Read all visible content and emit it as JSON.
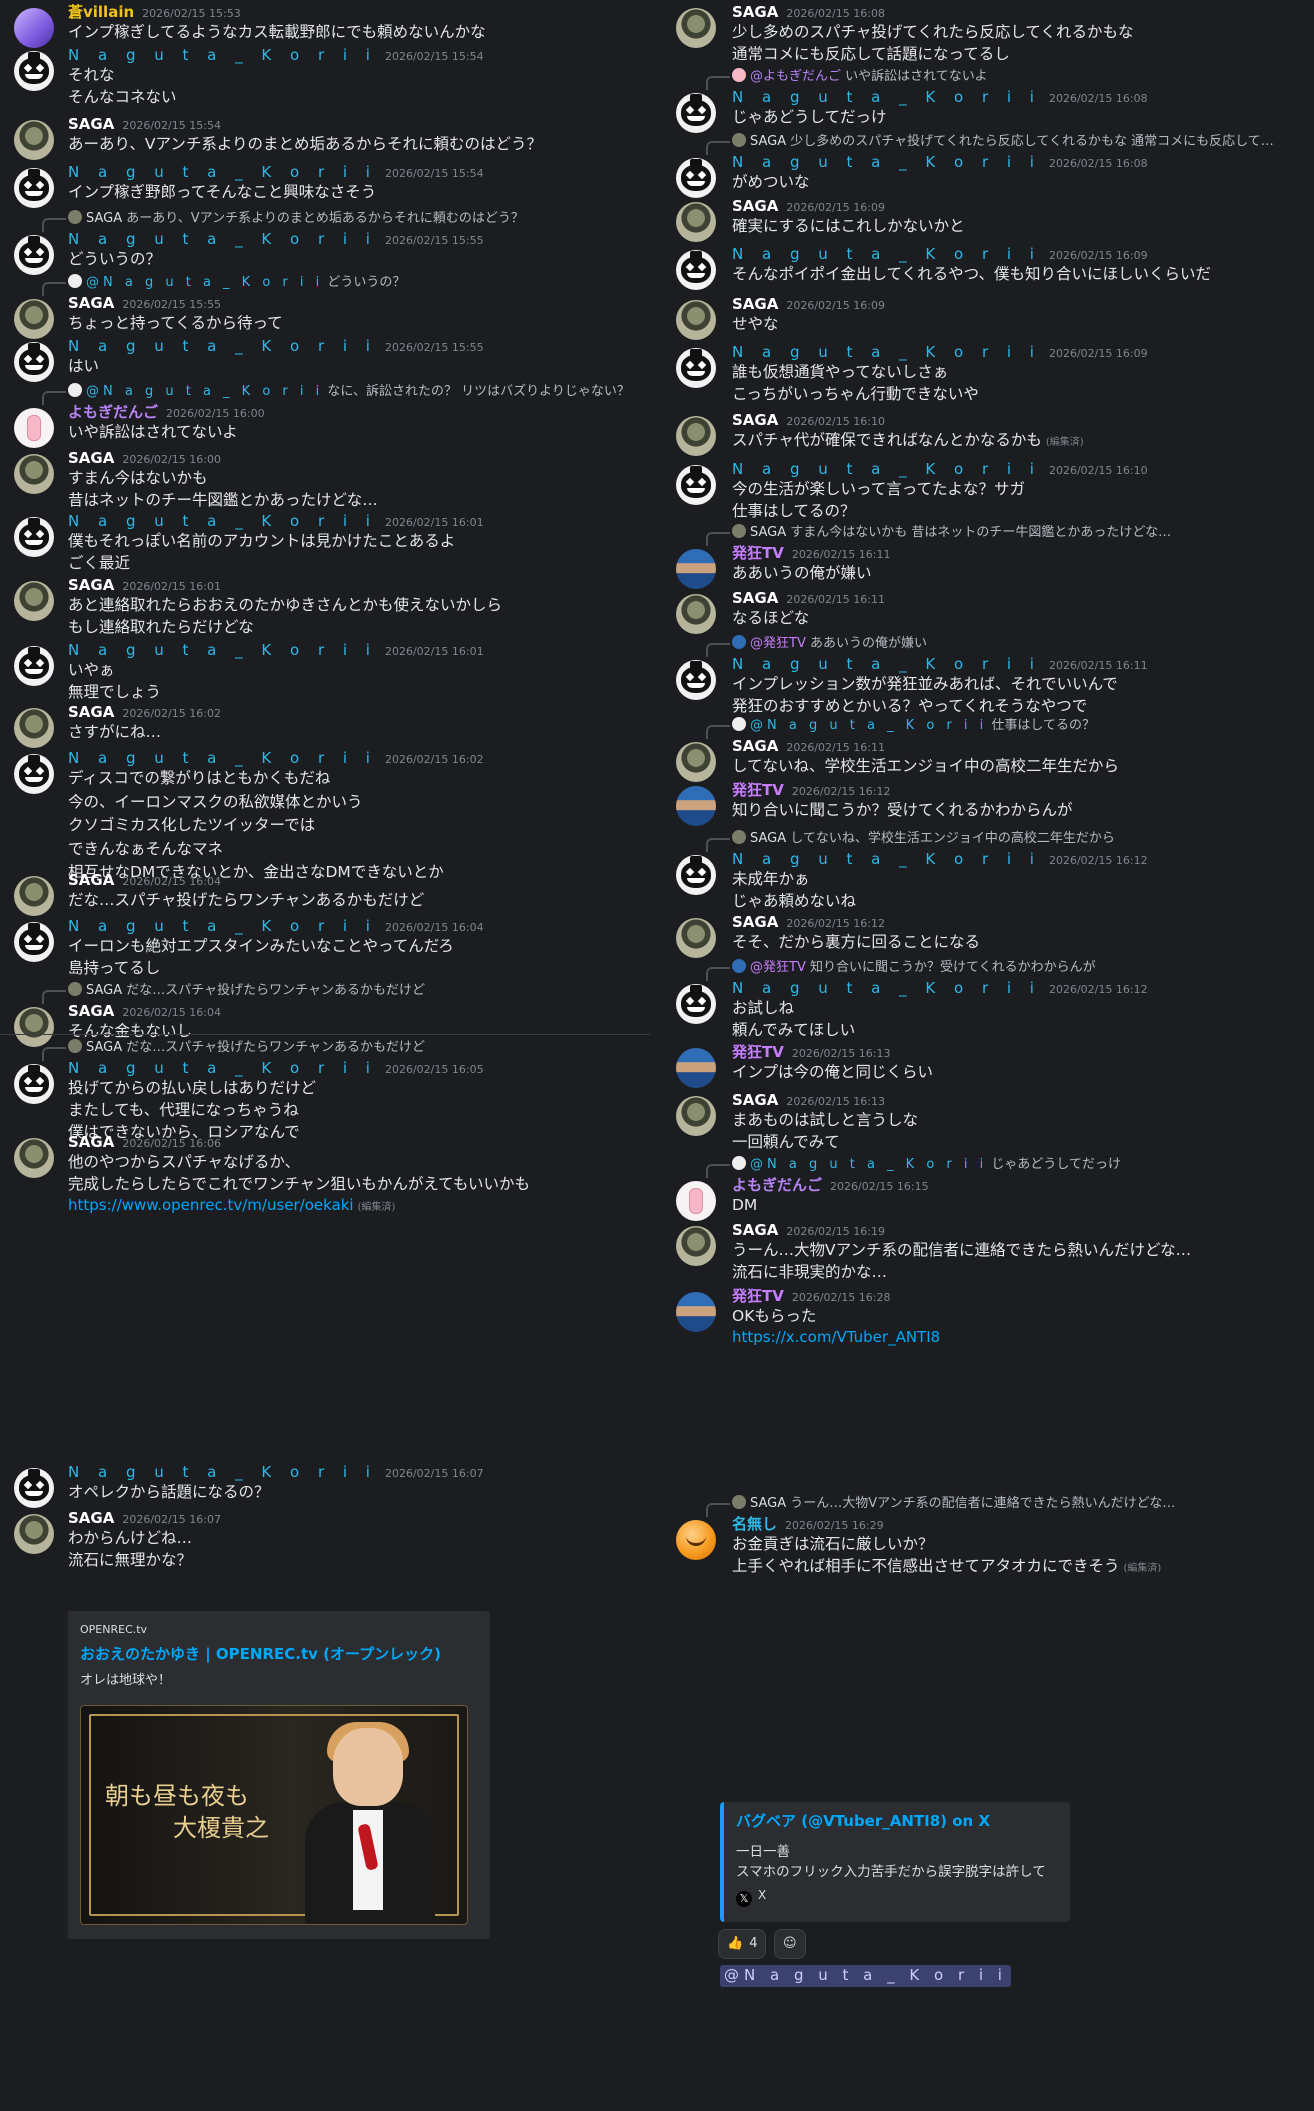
{
  "colors": {
    "background": "#1c1d21",
    "korii": "#2eb8e6",
    "villain": "#f0c419",
    "yomo": "#b784f5",
    "hakkyo": "#c77dff",
    "link": "#00a8fc"
  },
  "users": {
    "villain": "蒼villain",
    "korii": "N a g u t a _ K o r i i",
    "saga": "SAGA",
    "yomo": "よもぎだんご",
    "hakkyo": "発狂TV",
    "orange": "名無し"
  },
  "left": [
    {
      "user": "villain",
      "ts": "2026/02/15 15:53",
      "lines": [
        "インプ稼ぎしてるようなカス転載野郎にでも頼めないんかな"
      ]
    },
    {
      "user": "korii",
      "ts": "2026/02/15 15:54",
      "lines": [
        "それな",
        "そんなコネない"
      ]
    },
    {
      "user": "saga",
      "ts": "2026/02/15 15:54",
      "lines": [
        "あーあり、Vアンチ系よりのまとめ垢あるからそれに頼むのはどう？"
      ]
    },
    {
      "user": "korii",
      "ts": "2026/02/15 15:54",
      "lines": [
        "インプ稼ぎ野郎ってそんなこと興味なさそう"
      ]
    },
    {
      "user": "korii",
      "ts": "2026/02/15 15:55",
      "reply": {
        "user": "saga",
        "text": "あーあり、Vアンチ系よりのまとめ垢あるからそれに頼むのはどう？"
      },
      "lines": [
        "どういうの？"
      ]
    },
    {
      "user": "saga",
      "ts": "2026/02/15 15:55",
      "reply": {
        "user": "korii",
        "text": "どういうの？"
      },
      "lines": [
        "ちょっと持ってくるから待って"
      ]
    },
    {
      "user": "korii",
      "ts": "2026/02/15 15:55",
      "lines": [
        "はい"
      ]
    },
    {
      "user": "yomo",
      "ts": "2026/02/15 16:00",
      "reply": {
        "user": "korii",
        "text": "なに、訴訟されたの？ リツはバズりよりじゃない？"
      },
      "lines": [
        "いや訴訟はされてないよ"
      ]
    },
    {
      "user": "saga",
      "ts": "2026/02/15 16:00",
      "lines": [
        "すまん今はないかも",
        "昔はネットのチー牛図鑑とかあったけどな…"
      ]
    },
    {
      "user": "korii",
      "ts": "2026/02/15 16:01",
      "lines": [
        "僕もそれっぽい名前のアカウントは見かけたことあるよ",
        "ごく最近"
      ]
    },
    {
      "user": "saga",
      "ts": "2026/02/15 16:01",
      "lines": [
        "あと連絡取れたらおおえのたかゆきさんとかも使えないかしら",
        "もし連絡取れたらだけどな"
      ]
    },
    {
      "user": "korii",
      "ts": "2026/02/15 16:01",
      "lines": [
        "いやぁ",
        "無理でしょう"
      ]
    },
    {
      "user": "saga",
      "ts": "2026/02/15 16:02",
      "lines": [
        "さすがにね…"
      ]
    },
    {
      "user": "korii",
      "ts": "2026/02/15 16:02",
      "lines": [
        "ディスコでの繋がりはともかくもだね",
        "今の、イーロンマスクの私欲媒体とかいう",
        "クソゴミカス化したツイッターでは",
        "できんなぁそんなマネ",
        "相互せなDMできないとか、金出さなDMできないとか"
      ]
    },
    {
      "user": "saga",
      "ts": "2026/02/15 16:04",
      "lines": [
        "だな…スパチャ投げたらワンチャンあるかもだけど"
      ]
    },
    {
      "user": "korii",
      "ts": "2026/02/15 16:04",
      "lines": [
        "イーロンも絶対エプスタインみたいなことやってんだろ",
        "島持ってるし"
      ]
    },
    {
      "user": "saga",
      "ts": "2026/02/15 16:04",
      "reply": {
        "user": "saga",
        "text": "だな…スパチャ投げたらワンチャンあるかもだけど"
      },
      "lines": [
        "そんな金もないし"
      ]
    },
    {
      "user": "korii",
      "ts": "2026/02/15 16:05",
      "reply": {
        "user": "saga",
        "text": "だな…スパチャ投げたらワンチャンあるかもだけど"
      },
      "lines": [
        "投げてからの払い戻しはありだけど",
        "またしても、代理になっちゃうね",
        "僕はできないから、ロシアなんで"
      ]
    },
    {
      "user": "saga",
      "ts": "2026/02/15 16:06",
      "lines": [
        "他のやつからスパチャなげるか、",
        "完成したらしたらでこれでワンチャン狙いもかんがえてもいいかも"
      ],
      "link": "https://www.openrec.tv/m/user/oekaki",
      "edited": "(編集済)"
    },
    {
      "user": "korii",
      "ts": "2026/02/15 16:07",
      "lines": [
        "オペレクから話題になるの？"
      ]
    },
    {
      "user": "saga",
      "ts": "2026/02/15 16:07",
      "lines": [
        "わからんけどね…",
        "流石に無理かな？"
      ]
    }
  ],
  "embed": {
    "provider": "OPENREC.tv",
    "title": "おおえのたかゆき | OPENREC.tv (オープンレック)",
    "description": "オレは地球や！",
    "thumb_text": [
      "朝も昼も夜も",
      "大榎貴之"
    ]
  },
  "right": [
    {
      "user": "saga",
      "ts": "2026/02/15 16:08",
      "lines": [
        "少し多めのスパチャ投げてくれたら反応してくれるかもな",
        "通常コメにも反応して話題になってるし"
      ]
    },
    {
      "user": "korii",
      "ts": "2026/02/15 16:08",
      "reply": {
        "user": "yomo",
        "text": "いや訴訟はされてないよ"
      },
      "lines": [
        "じゃあどうしてだっけ"
      ]
    },
    {
      "user": "korii",
      "ts": "2026/02/15 16:08",
      "reply": {
        "user": "saga",
        "text": "少し多めのスパチャ投げてくれたら反応してくれるかもな 通常コメにも反応して…"
      },
      "lines": [
        "がめついな"
      ]
    },
    {
      "user": "saga",
      "ts": "2026/02/15 16:09",
      "lines": [
        "確実にするにはこれしかないかと"
      ]
    },
    {
      "user": "korii",
      "ts": "2026/02/15 16:09",
      "lines": [
        "そんなポイポイ金出してくれるやつ、僕も知り合いにほしいくらいだ"
      ]
    },
    {
      "user": "saga",
      "ts": "2026/02/15 16:09",
      "lines": [
        "せやな"
      ]
    },
    {
      "user": "korii",
      "ts": "2026/02/15 16:09",
      "lines": [
        "誰も仮想通貨やってないしさぁ",
        "こっちがいっちゃん行動できないや"
      ]
    },
    {
      "user": "saga",
      "ts": "2026/02/15 16:10",
      "lines": [
        "スパチャ代が確保できればなんとかなるかも"
      ],
      "edited": "(編集済)"
    },
    {
      "user": "korii",
      "ts": "2026/02/15 16:10",
      "lines": [
        "今の生活が楽しいって言ってたよな？サガ",
        "仕事はしてるの？"
      ]
    },
    {
      "user": "hakkyo",
      "ts": "2026/02/15 16:11",
      "reply": {
        "user": "saga",
        "text": "すまん今はないかも 昔はネットのチー牛図鑑とかあったけどな…"
      },
      "lines": [
        "ああいうの俺が嫌い"
      ]
    },
    {
      "user": "saga",
      "ts": "2026/02/15 16:11",
      "lines": [
        "なるほどな"
      ]
    },
    {
      "user": "korii",
      "ts": "2026/02/15 16:11",
      "reply": {
        "user": "hakkyo",
        "text": "ああいうの俺が嫌い"
      },
      "lines": [
        "インプレッション数が発狂並みあれば、それでいいんで",
        "発狂のおすすめとかいる？やってくれそうなやつで"
      ]
    },
    {
      "user": "saga",
      "ts": "2026/02/15 16:11",
      "reply": {
        "user": "korii",
        "text": "仕事はしてるの？"
      },
      "lines": [
        "してないね、学校生活エンジョイ中の高校二年生だから"
      ]
    },
    {
      "user": "hakkyo",
      "ts": "2026/02/15 16:12",
      "lines": [
        "知り合いに聞こうか？受けてくれるかわからんが"
      ]
    },
    {
      "user": "korii",
      "ts": "2026/02/15 16:12",
      "reply": {
        "user": "saga",
        "text": "してないね、学校生活エンジョイ中の高校二年生だから"
      },
      "lines": [
        "未成年かぁ",
        "じゃあ頼めないね"
      ]
    },
    {
      "user": "saga",
      "ts": "2026/02/15 16:12",
      "lines": [
        "そそ、だから裏方に回ることになる"
      ]
    },
    {
      "user": "korii",
      "ts": "2026/02/15 16:12",
      "reply": {
        "user": "hakkyo",
        "text": "知り合いに聞こうか？受けてくれるかわからんが"
      },
      "lines": [
        "お試しね",
        "頼んでみてほしい"
      ]
    },
    {
      "user": "hakkyo",
      "ts": "2026/02/15 16:13",
      "lines": [
        "インプは今の俺と同じくらい"
      ]
    },
    {
      "user": "saga",
      "ts": "2026/02/15 16:13",
      "lines": [
        "まあものは試しと言うしな",
        "一回頼んでみて"
      ]
    },
    {
      "user": "yomo",
      "ts": "2026/02/15 16:15",
      "reply": {
        "user": "korii",
        "text": "じゃあどうしてだっけ"
      },
      "lines": [
        "DM"
      ]
    },
    {
      "user": "saga",
      "ts": "2026/02/15 16:19",
      "lines": [
        "うーん…大物Vアンチ系の配信者に連絡できたら熱いんだけどな…",
        "流石に非現実的かな…"
      ]
    },
    {
      "user": "hakkyo",
      "ts": "2026/02/15 16:28",
      "lines": [
        "OKもらった"
      ],
      "link": "https://x.com/VTuber_ANTI8"
    },
    {
      "user": "orange",
      "ts": "2026/02/15 16:29",
      "reply": {
        "user": "saga",
        "text": "うーん…大物Vアンチ系の配信者に連絡できたら熱いんだけどな…"
      },
      "lines": [
        "お金貢ぎは流石に厳しいか？",
        "上手くやれば相手に不信感出させてアタオカにできそう"
      ],
      "edited": "(編集済)"
    }
  ],
  "xembed": {
    "title": "バグベア (@VTuber_ANTI8) on X",
    "lines": [
      "一日一善",
      "スマホのフリック入力苦手だから誤字脱字は許して"
    ],
    "footer": "X"
  },
  "reaction": {
    "emoji": "👍",
    "count": "4",
    "add_icon": "add-reaction-icon"
  },
  "mention": "@N a g u t a _ K o r i i"
}
